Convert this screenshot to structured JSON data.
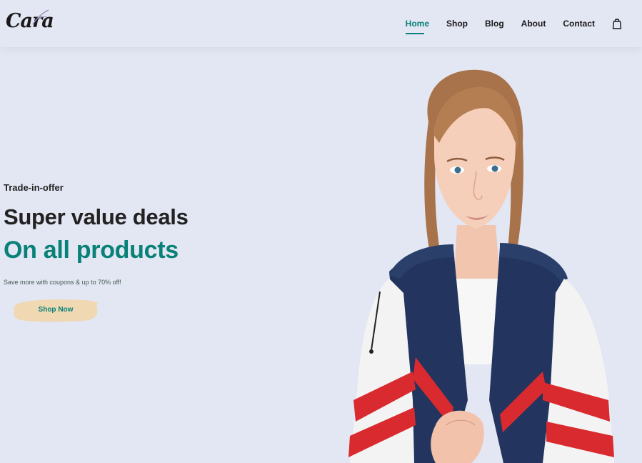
{
  "brand": {
    "logo_text": "Cara"
  },
  "nav": {
    "items": [
      {
        "label": "Home"
      },
      {
        "label": "Shop"
      },
      {
        "label": "Blog"
      },
      {
        "label": "About"
      },
      {
        "label": "Contact"
      }
    ],
    "active": "Home",
    "cart_icon": "shopping-bag-icon"
  },
  "hero": {
    "eyebrow": "Trade-in-offer",
    "title": "Super value deals",
    "subtitle": "On all products",
    "description": "Save more with coupons & up to 70% off!",
    "cta_label": "Shop Now"
  },
  "colors": {
    "background": "#e3e6f3",
    "accent": "#088178",
    "button_bg": "#f0d8b3",
    "text_dark": "#222222"
  }
}
